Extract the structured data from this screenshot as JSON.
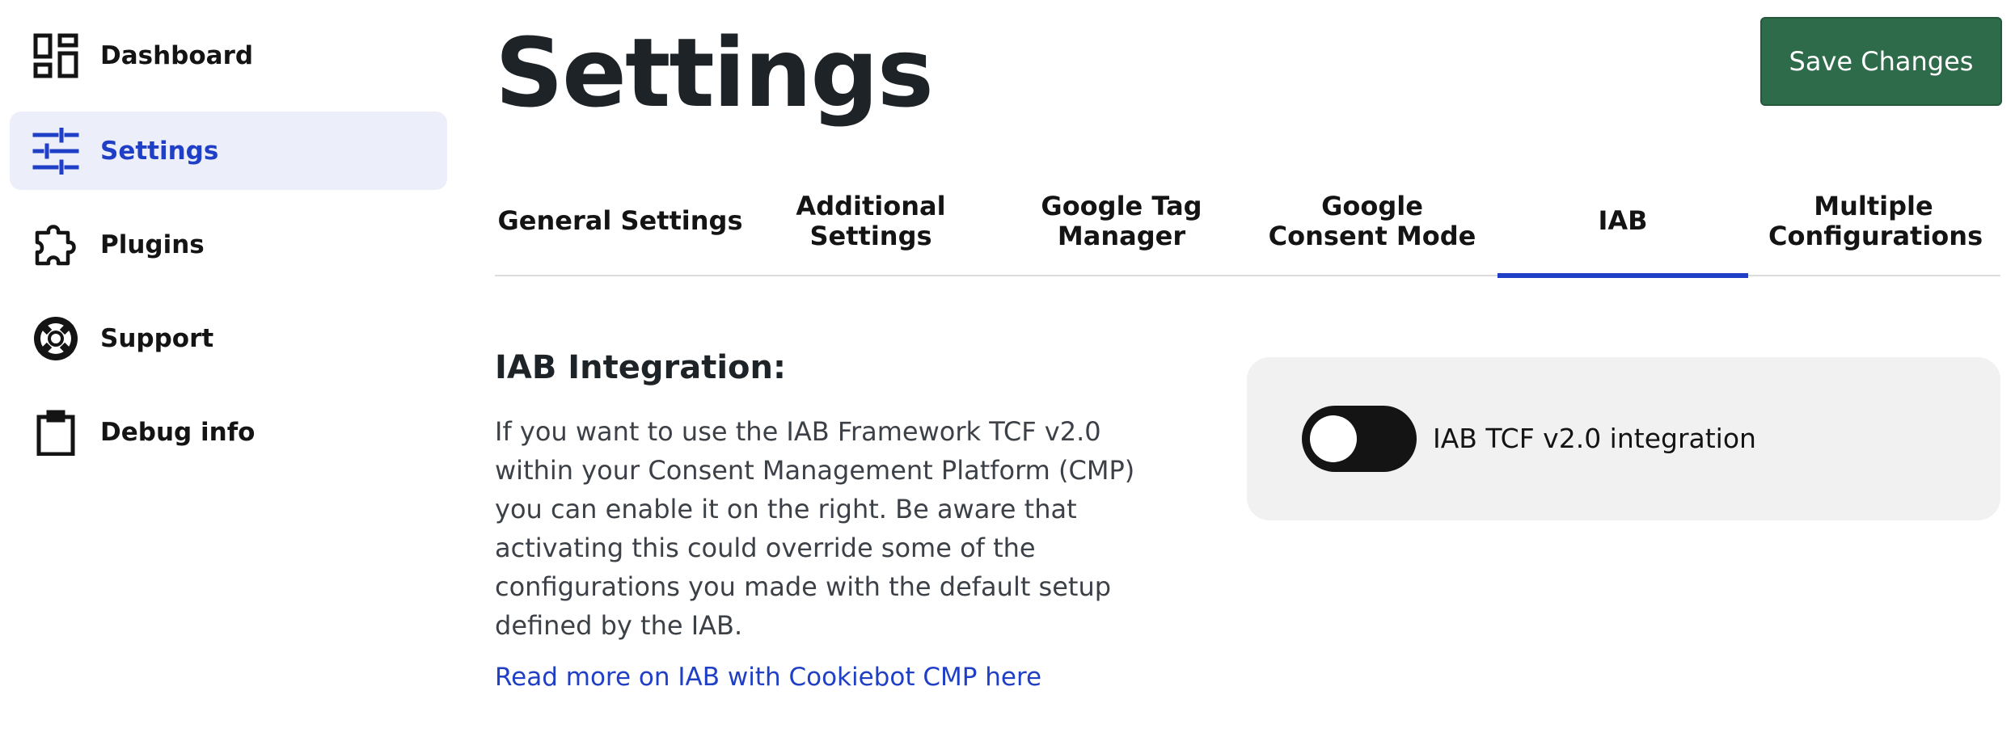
{
  "sidebar": {
    "items": [
      {
        "label": "Dashboard",
        "icon": "dashboard-icon",
        "active": false
      },
      {
        "label": "Settings",
        "icon": "sliders-icon",
        "active": true
      },
      {
        "label": "Plugins",
        "icon": "puzzle-icon",
        "active": false
      },
      {
        "label": "Support",
        "icon": "lifebuoy-icon",
        "active": false
      },
      {
        "label": "Debug info",
        "icon": "clipboard-icon",
        "active": false
      }
    ]
  },
  "header": {
    "title": "Settings",
    "save_label": "Save Changes"
  },
  "tabs": [
    {
      "label": "General Settings",
      "active": false
    },
    {
      "label": "Additional Settings",
      "active": false
    },
    {
      "label": "Google Tag Manager",
      "active": false
    },
    {
      "label": "Google Consent Mode",
      "active": false
    },
    {
      "label": "IAB",
      "active": true
    },
    {
      "label": "Multiple Configurations",
      "active": false
    }
  ],
  "iab": {
    "title": "IAB Integration:",
    "description": "If you want to use the IAB Framework TCF v2.0 within your Consent Management Platform (CMP) you can enable it on the right. Be aware that activating this could override some of the configurations you made with the default setup defined by the IAB.",
    "link_text": "Read more on IAB with Cookiebot CMP here",
    "toggle_label": "IAB TCF v2.0 integration",
    "toggle_on": false
  },
  "colors": {
    "accent": "#1f3fc6",
    "save_button": "#2e6b4a",
    "active_nav_bg": "#eceef9",
    "card_bg": "#f1f1f1"
  }
}
